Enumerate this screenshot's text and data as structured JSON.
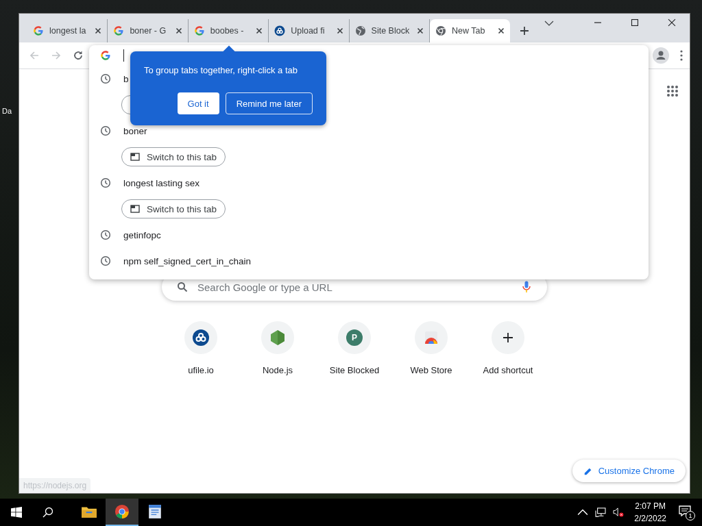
{
  "desktop": {
    "icon_label": "Da"
  },
  "tabs": [
    {
      "title": "longest la",
      "kind": "google",
      "selected": false
    },
    {
      "title": "boner - G",
      "kind": "google",
      "selected": false
    },
    {
      "title": "boobes -",
      "kind": "google",
      "selected": false
    },
    {
      "title": "Upload fi",
      "kind": "cloud",
      "selected": false
    },
    {
      "title": "Site Block",
      "kind": "globe",
      "selected": false
    },
    {
      "title": "New Tab",
      "kind": "chrome",
      "selected": true
    }
  ],
  "omnibox": {
    "suggestions": [
      {
        "text": "b",
        "switch": true
      },
      {
        "text": "boner",
        "switch": true,
        "switch_label": "Switch to this tab"
      },
      {
        "text": "longest lasting sex",
        "switch": true,
        "switch_label": "Switch to this tab"
      },
      {
        "text": "getinfopc",
        "switch": false
      },
      {
        "text": "npm self_signed_cert_in_chain",
        "switch": false
      }
    ]
  },
  "promo": {
    "message": "To group tabs together, right-click a tab",
    "buttons": [
      {
        "label": "Got it",
        "kind": "primary"
      },
      {
        "label": "Remind me later",
        "kind": "secondary"
      }
    ]
  },
  "search": {
    "placeholder": "Search Google or type a URL"
  },
  "shortcuts": [
    {
      "label": "ufile.io",
      "kind": "cloud"
    },
    {
      "label": "Node.js",
      "kind": "hexagon"
    },
    {
      "label": "Site Blocked",
      "kind": "letter",
      "letter": "P"
    },
    {
      "label": "Web Store",
      "kind": "store"
    },
    {
      "label": "Add shortcut",
      "kind": "add"
    }
  ],
  "customize_button": "Customize Chrome",
  "status_url": "https://nodejs.org",
  "taskbar": {
    "apps": [
      {
        "kind": "folder",
        "selected": false
      },
      {
        "kind": "chrome",
        "selected": true
      },
      {
        "kind": "document",
        "selected": false
      }
    ],
    "time": "2:07 PM",
    "date": "2/2/2022",
    "notification_count": "1"
  }
}
